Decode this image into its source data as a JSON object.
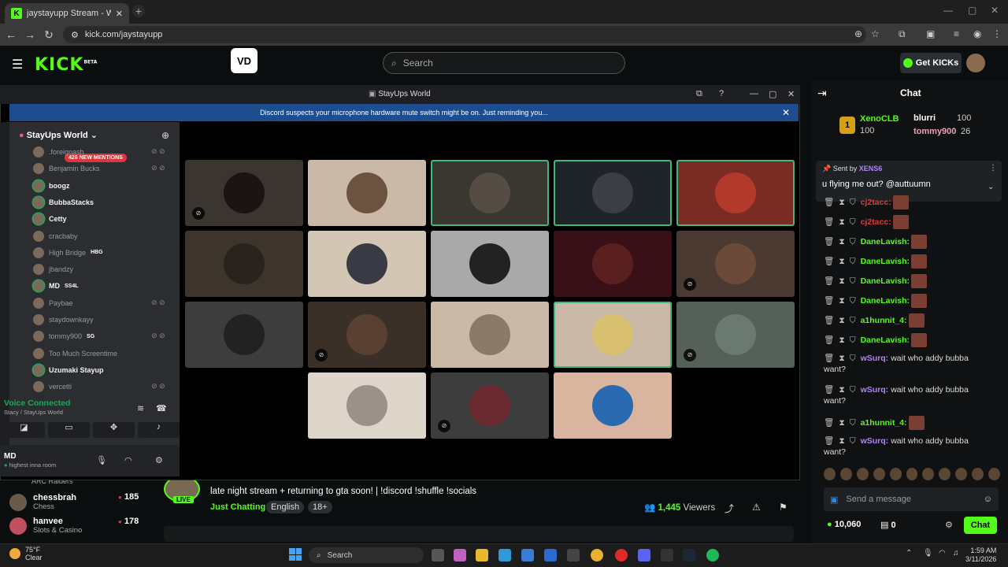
{
  "browser": {
    "tab_title": "jaystayupp Stream - Watch Live",
    "url": "kick.com/jaystayupp"
  },
  "kick": {
    "logo": "KICK",
    "logo_sup": "BETA",
    "search_placeholder": "Search",
    "get_kicks": "Get KICKs",
    "chat": {
      "title": "Chat",
      "leaderboard": [
        {
          "rank": "1",
          "name": "XenoCLB",
          "score": "100"
        },
        {
          "name": "blurri",
          "score": "100"
        },
        {
          "name": "tommy900",
          "score": "26"
        }
      ],
      "pinned": {
        "sent_by_label": "Sent by",
        "sent_by_user": "XENS6",
        "text": "u flying me out? @auttuumn"
      },
      "messages": [
        {
          "user": "cj2tacc:",
          "text": "",
          "color": "#e03a3a"
        },
        {
          "user": "cj2tacc:",
          "text": "",
          "color": "#e03a3a"
        },
        {
          "user": "DaneLavish:",
          "text": "",
          "color": "#53fc18"
        },
        {
          "user": "DaneLavish:",
          "text": "",
          "color": "#53fc18"
        },
        {
          "user": "DaneLavish:",
          "text": "",
          "color": "#53fc18"
        },
        {
          "user": "DaneLavish:",
          "text": "",
          "color": "#53fc18"
        },
        {
          "user": "a1hunnit_4:",
          "text": "",
          "color": "#53fc18"
        },
        {
          "user": "DaneLavish:",
          "text": "",
          "color": "#53fc18"
        },
        {
          "user": "wSurq:",
          "text": "wait who addy bubba",
          "text2": "want?",
          "color": "#b482ff"
        },
        {
          "user": "wSurq:",
          "text": "wait who addy bubba",
          "text2": "want?",
          "color": "#b482ff"
        },
        {
          "user": "a1hunnit_4:",
          "text": "",
          "color": "#53fc18"
        },
        {
          "user": "wSurq:",
          "text": "wait who addy bubba",
          "text2": "want?",
          "color": "#b482ff"
        }
      ],
      "send_placeholder": "Send a message",
      "kicks_balance": "10,060",
      "other_count": "0",
      "chat_button": "Chat"
    },
    "stream": {
      "title": "late night stream + returning to gta soon! | !discord !shuffle !socials",
      "category": "Just Chatting",
      "tags": [
        "English",
        "18+"
      ],
      "viewers": "1,445",
      "viewers_label": "Viewers",
      "live": "LIVE"
    },
    "followed": [
      {
        "name": "ARC Raiders",
        "category": "",
        "count": ""
      },
      {
        "name": "chessbrah",
        "category": "Chess",
        "count": "185"
      },
      {
        "name": "hanvee",
        "category": "Slots & Casino",
        "count": "178"
      }
    ]
  },
  "discord": {
    "window_title": "StayUps World",
    "notice": "Discord suspects your microphone hardware mute switch might be on. Just reminding you...",
    "server_name": "StayUps World",
    "mentions": "426 NEW MENTIONS",
    "voice_members": [
      {
        "name": ".foreignash",
        "bold": false,
        "mute": true
      },
      {
        "name": "Benjamin Bucks",
        "bold": false,
        "mute": true
      },
      {
        "name": "boogz",
        "bold": true,
        "mute": false
      },
      {
        "name": "BubbaStacks",
        "bold": true,
        "mute": false
      },
      {
        "name": "Cetty",
        "bold": true,
        "mute": false
      },
      {
        "name": "cracbaby",
        "bold": false,
        "mute": false
      },
      {
        "name": "High Bridge",
        "tag": "HBG",
        "bold": false,
        "mute": false
      },
      {
        "name": "jbandzy",
        "bold": false,
        "mute": false
      },
      {
        "name": "MD",
        "tag": "SS4L",
        "bold": true,
        "mute": false
      },
      {
        "name": "Paybae",
        "bold": false,
        "mute": true
      },
      {
        "name": "staydownkayy",
        "bold": false,
        "mute": false
      },
      {
        "name": "tommy900",
        "tag": "SG",
        "bold": false,
        "mute": true
      },
      {
        "name": "Too Much Screentime",
        "bold": false,
        "mute": false
      },
      {
        "name": "Uzumaki Stayup",
        "bold": true,
        "mute": false
      },
      {
        "name": "vercetti",
        "bold": false,
        "mute": true
      }
    ],
    "voice_connected": "Voice Connected",
    "voice_channel": "Stacy / StayUps World",
    "user_name": "MD",
    "user_status": "highest inna room"
  },
  "taskbar": {
    "temp": "75°F",
    "weather": "Clear",
    "search": "Search",
    "time": "1:59 AM",
    "date": "3/11/2026"
  }
}
